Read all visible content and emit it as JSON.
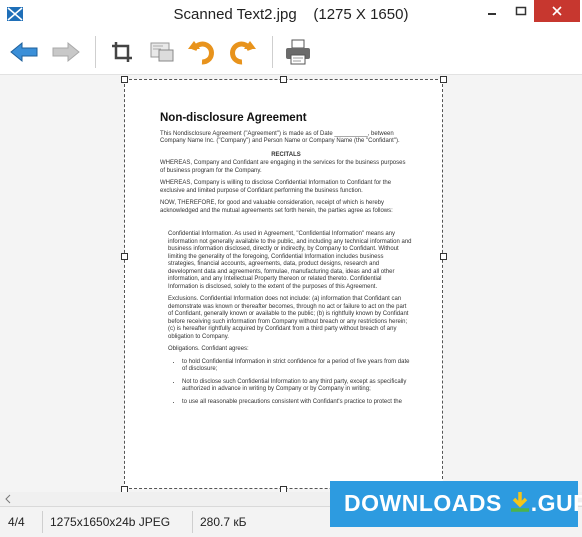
{
  "window": {
    "title": "Scanned Text2.jpg",
    "dimensions": "(1275 X 1650)"
  },
  "toolbar": {
    "buttons": [
      "back-arrow-icon",
      "forward-arrow-icon",
      "crop-icon",
      "resize-icon",
      "rotate-left-icon",
      "rotate-right-icon",
      "print-icon"
    ]
  },
  "document": {
    "title": "Non-disclosure Agreement",
    "intro": "This Nondisclosure Agreement (\"Agreement\") is made as of Date __________, between Company Name Inc. (\"Company\") and Person Name or Company Name (the \"Confidant\").",
    "recitals_heading": "RECITALS",
    "whereas_1": "WHEREAS, Company and Confidant are engaging in the services for the business purposes of business program for the Company.",
    "whereas_2": "WHEREAS, Company is willing to disclose Confidential Information to Confidant for the exclusive and limited purpose of Confidant performing the business function.",
    "now_therefore": "NOW, THEREFORE, for good and valuable consideration, receipt of which is hereby acknowledged and the mutual agreements set forth herein, the parties agree as follows:",
    "confidential": "Confidential Information. As used in Agreement, \"Confidential Information\" means any information not generally available to the public, and including any technical information and business information disclosed, directly or indirectly, by Company to Confidant. Without limiting the generality of the foregoing, Confidential Information includes business strategies, financial accounts, agreements, data, product designs, research and development data and agreements, formulae, manufacturing data, ideas and all other information, and any Intellectual Property thereon or related thereto. Confidential Information is disclosed, solely to the extent of the purposes of this Agreement.",
    "exclusions": "Exclusions. Confidential Information does not include: (a) information that Confidant can demonstrate was known or thereafter becomes, through no act or failure to act on the part of Confidant, generally known or available to the public; (b) is rightfully known by Confidant before receiving such information from Company without breach or any restrictions herein; (c) is hereafter rightfully acquired by Confidant from a third party without breach of any obligation to Company.",
    "obligations": "Obligations. Confidant agrees:",
    "bullets": [
      "to hold Confidential Information in strict confidence for a period of five years from date of disclosure;",
      "Not to disclose such Confidential Information to any third party, except as specifically authorized in advance in writing by Company or by Company in writing;",
      "to use all reasonable precautions consistent with Confidant's practice to protect the"
    ]
  },
  "status": {
    "page": "4/4",
    "info": "1275x1650x24b JPEG",
    "size": "280.7 кБ"
  },
  "watermark": {
    "text": "DOWNLOADS",
    "suffix": ".GURU"
  }
}
